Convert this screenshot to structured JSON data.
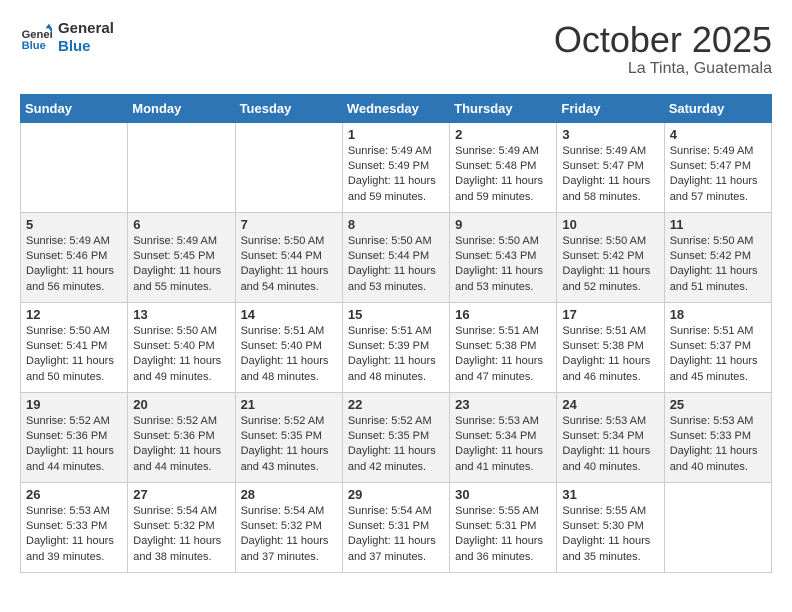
{
  "header": {
    "logo_line1": "General",
    "logo_line2": "Blue",
    "month": "October 2025",
    "location": "La Tinta, Guatemala"
  },
  "days_of_week": [
    "Sunday",
    "Monday",
    "Tuesday",
    "Wednesday",
    "Thursday",
    "Friday",
    "Saturday"
  ],
  "weeks": [
    [
      {
        "day": "",
        "content": ""
      },
      {
        "day": "",
        "content": ""
      },
      {
        "day": "",
        "content": ""
      },
      {
        "day": "1",
        "content": "Sunrise: 5:49 AM\nSunset: 5:49 PM\nDaylight: 11 hours\nand 59 minutes."
      },
      {
        "day": "2",
        "content": "Sunrise: 5:49 AM\nSunset: 5:48 PM\nDaylight: 11 hours\nand 59 minutes."
      },
      {
        "day": "3",
        "content": "Sunrise: 5:49 AM\nSunset: 5:47 PM\nDaylight: 11 hours\nand 58 minutes."
      },
      {
        "day": "4",
        "content": "Sunrise: 5:49 AM\nSunset: 5:47 PM\nDaylight: 11 hours\nand 57 minutes."
      }
    ],
    [
      {
        "day": "5",
        "content": "Sunrise: 5:49 AM\nSunset: 5:46 PM\nDaylight: 11 hours\nand 56 minutes."
      },
      {
        "day": "6",
        "content": "Sunrise: 5:49 AM\nSunset: 5:45 PM\nDaylight: 11 hours\nand 55 minutes."
      },
      {
        "day": "7",
        "content": "Sunrise: 5:50 AM\nSunset: 5:44 PM\nDaylight: 11 hours\nand 54 minutes."
      },
      {
        "day": "8",
        "content": "Sunrise: 5:50 AM\nSunset: 5:44 PM\nDaylight: 11 hours\nand 53 minutes."
      },
      {
        "day": "9",
        "content": "Sunrise: 5:50 AM\nSunset: 5:43 PM\nDaylight: 11 hours\nand 53 minutes."
      },
      {
        "day": "10",
        "content": "Sunrise: 5:50 AM\nSunset: 5:42 PM\nDaylight: 11 hours\nand 52 minutes."
      },
      {
        "day": "11",
        "content": "Sunrise: 5:50 AM\nSunset: 5:42 PM\nDaylight: 11 hours\nand 51 minutes."
      }
    ],
    [
      {
        "day": "12",
        "content": "Sunrise: 5:50 AM\nSunset: 5:41 PM\nDaylight: 11 hours\nand 50 minutes."
      },
      {
        "day": "13",
        "content": "Sunrise: 5:50 AM\nSunset: 5:40 PM\nDaylight: 11 hours\nand 49 minutes."
      },
      {
        "day": "14",
        "content": "Sunrise: 5:51 AM\nSunset: 5:40 PM\nDaylight: 11 hours\nand 48 minutes."
      },
      {
        "day": "15",
        "content": "Sunrise: 5:51 AM\nSunset: 5:39 PM\nDaylight: 11 hours\nand 48 minutes."
      },
      {
        "day": "16",
        "content": "Sunrise: 5:51 AM\nSunset: 5:38 PM\nDaylight: 11 hours\nand 47 minutes."
      },
      {
        "day": "17",
        "content": "Sunrise: 5:51 AM\nSunset: 5:38 PM\nDaylight: 11 hours\nand 46 minutes."
      },
      {
        "day": "18",
        "content": "Sunrise: 5:51 AM\nSunset: 5:37 PM\nDaylight: 11 hours\nand 45 minutes."
      }
    ],
    [
      {
        "day": "19",
        "content": "Sunrise: 5:52 AM\nSunset: 5:36 PM\nDaylight: 11 hours\nand 44 minutes."
      },
      {
        "day": "20",
        "content": "Sunrise: 5:52 AM\nSunset: 5:36 PM\nDaylight: 11 hours\nand 44 minutes."
      },
      {
        "day": "21",
        "content": "Sunrise: 5:52 AM\nSunset: 5:35 PM\nDaylight: 11 hours\nand 43 minutes."
      },
      {
        "day": "22",
        "content": "Sunrise: 5:52 AM\nSunset: 5:35 PM\nDaylight: 11 hours\nand 42 minutes."
      },
      {
        "day": "23",
        "content": "Sunrise: 5:53 AM\nSunset: 5:34 PM\nDaylight: 11 hours\nand 41 minutes."
      },
      {
        "day": "24",
        "content": "Sunrise: 5:53 AM\nSunset: 5:34 PM\nDaylight: 11 hours\nand 40 minutes."
      },
      {
        "day": "25",
        "content": "Sunrise: 5:53 AM\nSunset: 5:33 PM\nDaylight: 11 hours\nand 40 minutes."
      }
    ],
    [
      {
        "day": "26",
        "content": "Sunrise: 5:53 AM\nSunset: 5:33 PM\nDaylight: 11 hours\nand 39 minutes."
      },
      {
        "day": "27",
        "content": "Sunrise: 5:54 AM\nSunset: 5:32 PM\nDaylight: 11 hours\nand 38 minutes."
      },
      {
        "day": "28",
        "content": "Sunrise: 5:54 AM\nSunset: 5:32 PM\nDaylight: 11 hours\nand 37 minutes."
      },
      {
        "day": "29",
        "content": "Sunrise: 5:54 AM\nSunset: 5:31 PM\nDaylight: 11 hours\nand 37 minutes."
      },
      {
        "day": "30",
        "content": "Sunrise: 5:55 AM\nSunset: 5:31 PM\nDaylight: 11 hours\nand 36 minutes."
      },
      {
        "day": "31",
        "content": "Sunrise: 5:55 AM\nSunset: 5:30 PM\nDaylight: 11 hours\nand 35 minutes."
      },
      {
        "day": "",
        "content": ""
      }
    ]
  ]
}
